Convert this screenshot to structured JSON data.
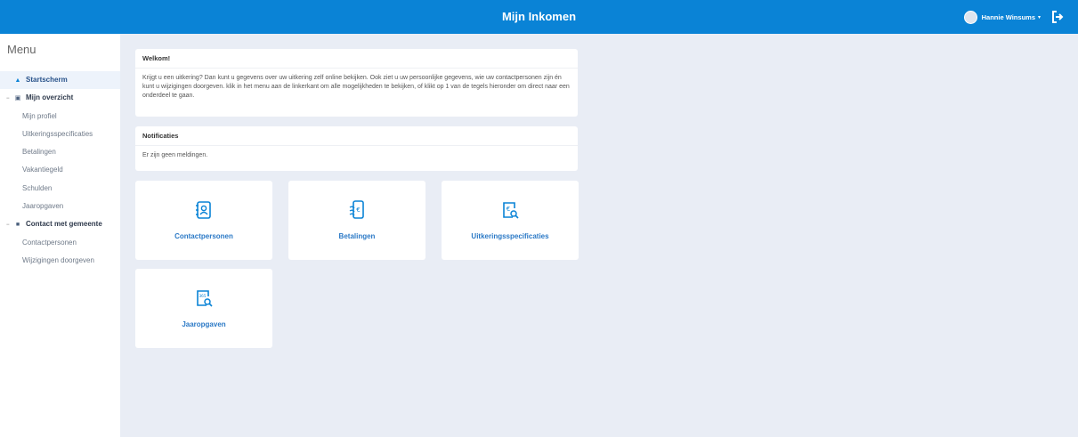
{
  "app": {
    "title": "Mijn Inkomen"
  },
  "user": {
    "name": "Hannie Winsums",
    "caret": "▾"
  },
  "menu": {
    "title": "Menu",
    "items": [
      {
        "label": "Startscherm"
      },
      {
        "label": "Mijn overzicht"
      },
      {
        "label": "Mijn profiel"
      },
      {
        "label": "Uitkeringsspecificaties"
      },
      {
        "label": "Betalingen"
      },
      {
        "label": "Vakantiegeld"
      },
      {
        "label": "Schulden"
      },
      {
        "label": "Jaaropgaven"
      },
      {
        "label": "Contact met gemeente"
      },
      {
        "label": "Contactpersonen"
      },
      {
        "label": "Wijzigingen doorgeven"
      }
    ]
  },
  "welcome": {
    "title": "Welkom!",
    "text": "Krijgt u een uitkering? Dan kunt u gegevens over uw uitkering zelf online bekijken. Ook ziet u uw persoonlijke gegevens, wie uw contactpersonen zijn én kunt u wijzigingen doorgeven. klik in het menu aan de linkerkant om alle mogelijkheden te bekijken, of klikt op 1 van de tegels hieronder om direct naar een onderdeel te gaan."
  },
  "notifications": {
    "title": "Notificaties",
    "text": "Er zijn geen meldingen."
  },
  "tiles": [
    {
      "label": "Contactpersonen",
      "icon": "contact-book-icon"
    },
    {
      "label": "Betalingen",
      "icon": "payment-phone-icon"
    },
    {
      "label": "Uitkeringsspecificaties",
      "icon": "euro-search-icon"
    },
    {
      "label": "Jaaropgaven",
      "icon": "year-search-icon",
      "icon_text": "365"
    }
  ],
  "colors": {
    "accent": "#0a83d6",
    "background": "#e9edf5",
    "tile_text": "#2b79c6"
  }
}
